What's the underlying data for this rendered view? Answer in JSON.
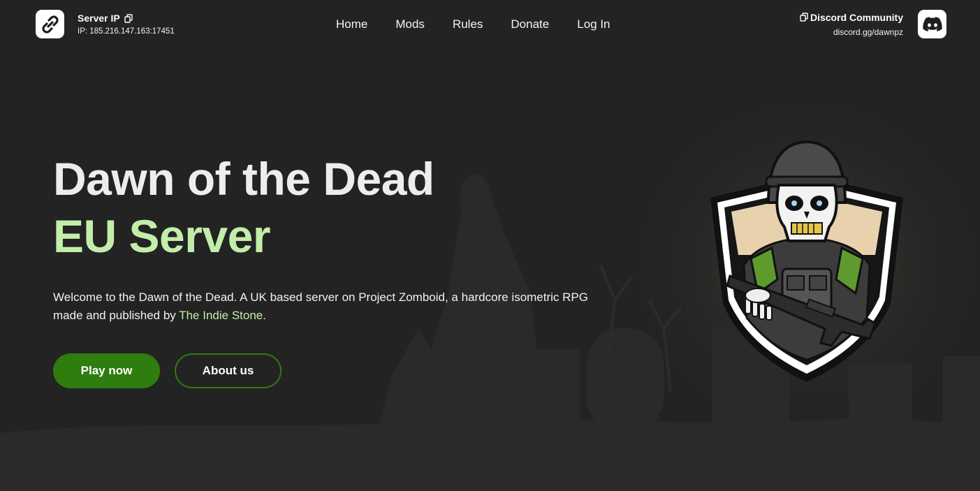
{
  "header": {
    "server_title": "Server IP",
    "server_ip": "IP: 185.216.147.163:17451",
    "nav": [
      "Home",
      "Mods",
      "Rules",
      "Donate",
      "Log In"
    ],
    "discord_title": "Discord Community",
    "discord_link": "discord.gg/dawnpz"
  },
  "hero": {
    "title_line1": "Dawn of the Dead",
    "title_line2": "EU Server",
    "description_before": "Welcome to the Dawn of the Dead. A UK based server on Project Zomboid, a hardcore isometric RPG made and published by ",
    "description_link": "The Indie Stone",
    "description_after": ".",
    "primary_button": "Play now",
    "secondary_button": "About us"
  },
  "icons": {
    "server": "link-icon",
    "copy": "copy-icon",
    "discord": "discord-icon",
    "logo": "skeleton-soldier-shield-logo"
  },
  "colors": {
    "background": "#232323",
    "accent_green": "#2f7c0f",
    "title_green": "#c3eeaa"
  }
}
